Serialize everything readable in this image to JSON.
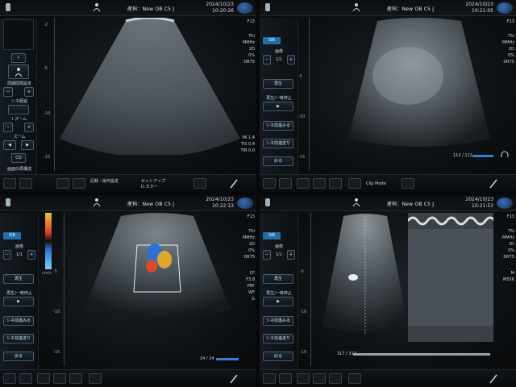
{
  "panels": [
    {
      "preset": "産科：New OB C5 J",
      "date": "2024/10/23",
      "time": "10:20:26",
      "left_controls": {
        "box1": "Ⅰ",
        "item_a": "周期間隔設定",
        "pm_minus": "−",
        "pm_plus": "+",
        "item_b": "シネ経過",
        "item_c": "Ⅰ.ズーム",
        "item_d": "ズーム",
        "item_e": "CO",
        "item_f": "画面の再構成"
      },
      "depth_ticks": [
        "-2",
        "-5",
        "-10",
        "-15"
      ],
      "right_values": [
        "F13",
        "Thi",
        "MMHz",
        "2D",
        "0%",
        "DR75",
        "MI 1.4",
        "TIS 0.4",
        "TIB 0.0"
      ],
      "bottom": {
        "text1": "記録・操作設定",
        "text2": "セットアップ",
        "text3": "D.カラー"
      },
      "logo": "KONICA MINOLTA"
    },
    {
      "preset": "産科：New OB C5 J",
      "date": "2024/10/23",
      "time": "10:21:05",
      "tab": "SIR",
      "left_controls": {
        "label_top": "画像",
        "pm_minus": "−",
        "pm_value": "1/1",
        "pm_plus": "+",
        "btn1": "再生",
        "btn2": "再生/一時停止",
        "btn3": "▶",
        "btn4": "シネ前進みる",
        "btn5": "シネ前進送り",
        "btn6": "戻る"
      },
      "depth_ticks": [
        "-5",
        "-10",
        "-15"
      ],
      "right_values": [
        "F13",
        "Thi",
        "MMHz",
        "2D",
        "0%",
        "DR75"
      ],
      "frames": "112 / 112",
      "bottom": {
        "text1": "Clip Mode"
      },
      "logo": "KONICA MINOLTA"
    },
    {
      "preset": "産科：New OB C5 J",
      "date": "2024/10/23",
      "time": "10:22:13",
      "tab": "SIR",
      "left_controls": {
        "label_top": "画像",
        "pm_minus": "−",
        "pm_value": "1/1",
        "pm_plus": "+",
        "btn1": "再生",
        "btn2": "再生/一時停止",
        "btn3": "▶",
        "btn4": "シネ前進みる",
        "btn5": "シネ前進送り",
        "btn6": "戻る"
      },
      "depth_ticks": [
        "-5",
        "-10",
        "-15"
      ],
      "color_scale": [
        "cm/s",
        "-9.6",
        "+9.6"
      ],
      "right_values": [
        "F13",
        "Thi",
        "MMHz",
        "2D",
        "0%",
        "DR75",
        "CF",
        "F3.8",
        "PRF",
        "WF",
        "G"
      ],
      "frames": "24 / 24",
      "logo": "KONICA MINOLTA"
    },
    {
      "preset": "産科：New OB C5 J",
      "date": "2024/10/23",
      "time": "10:21:53",
      "tab": "SIR",
      "left_controls": {
        "label_top": "画像",
        "pm_minus": "−",
        "pm_value": "1/1",
        "pm_plus": "+",
        "btn1": "再生",
        "btn2": "再生/一時停止",
        "btn3": "▶",
        "btn4": "シネ前進みる",
        "btn5": "シネ前進送り",
        "btn6": "戻る"
      },
      "depth_ticks": [
        "-5",
        "-10",
        "-15"
      ],
      "right_values": [
        "F13",
        "Thi",
        "MMHz",
        "2D",
        "0%",
        "DR75",
        "M",
        "M55K"
      ],
      "frames": "317 / 317",
      "logo": "KONICA MINOLTA"
    }
  ],
  "colors": {
    "accent": "#2f7fd6",
    "tab": "#1e6fa8"
  }
}
